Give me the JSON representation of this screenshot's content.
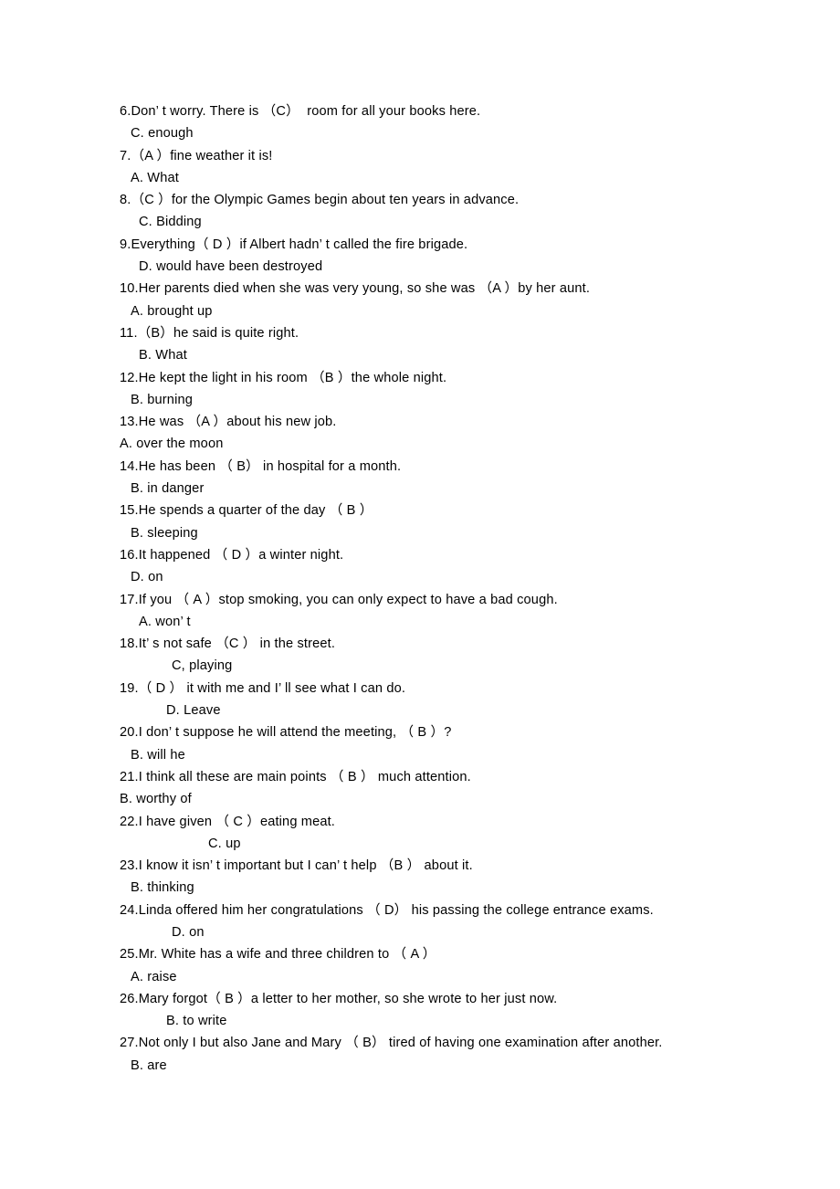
{
  "document": {
    "type": "grammar-exercise-answer-key",
    "first_item_number": 6,
    "last_item_number": 27,
    "items": [
      {
        "number": "6",
        "question": "6.Don’ t worry. There is （C）  room for all your books here.",
        "answer": "C. enough",
        "answer_indent": "indent-1"
      },
      {
        "number": "7",
        "question": "7.（A ）fine weather it is!",
        "answer": "A. What",
        "answer_indent": "indent-1"
      },
      {
        "number": "8",
        "question": "8.（C ）for the Olympic Games begin about ten years in advance.",
        "answer": "C. Bidding",
        "answer_indent": "indent-2"
      },
      {
        "number": "9",
        "question": "9.Everything（ D ）if Albert hadn’ t called the fire brigade.",
        "answer": "D. would have been destroyed",
        "answer_indent": "indent-2"
      },
      {
        "number": "10",
        "question": "10.Her parents died when she was very young, so she was （A ）by her aunt.",
        "answer": "A. brought up",
        "answer_indent": "indent-1"
      },
      {
        "number": "11",
        "question": "11.（B）he said is quite right.",
        "answer": "B. What",
        "answer_indent": "indent-2"
      },
      {
        "number": "12",
        "question": "12.He kept the light in his room （B ）the whole night.",
        "answer": "B. burning",
        "answer_indent": "indent-1"
      },
      {
        "number": "13",
        "question": "13.He was （A ）about his new job.",
        "answer": "A. over the moon",
        "answer_indent": "indent-0"
      },
      {
        "number": "14",
        "question": "14.He has been （ B） in hospital for a month.",
        "answer": "B. in danger",
        "answer_indent": "indent-1"
      },
      {
        "number": "15",
        "question": "15.He spends a quarter of the day （ B ）",
        "answer": "B. sleeping",
        "answer_indent": "indent-1"
      },
      {
        "number": "16",
        "question": "16.It happened （ D ）a winter night.",
        "answer": "D. on",
        "answer_indent": "indent-1"
      },
      {
        "number": "17",
        "question": "17.If you （ A ）stop smoking, you can only expect to have a bad cough.",
        "answer": "A. won’ t",
        "answer_indent": "indent-2"
      },
      {
        "number": "18",
        "question": "18.It’ s not safe （C ） in the street.",
        "answer": "C, playing",
        "answer_indent": "indent-5"
      },
      {
        "number": "19",
        "question": "19.（ D ） it with me and I’ ll see what I can do.",
        "answer": "D. Leave",
        "answer_indent": "indent-4"
      },
      {
        "number": "20",
        "question": "20.I don’ t suppose he will attend the meeting, （ B ）?",
        "answer": "B. will he",
        "answer_indent": "indent-1"
      },
      {
        "number": "21",
        "question": "21.I think all these are main points （ B ） much attention.",
        "answer": "B. worthy of",
        "answer_indent": "indent-0"
      },
      {
        "number": "22",
        "question": "22.I have given （ C ）eating meat.",
        "answer": "C. up",
        "answer_indent": "indent-7"
      },
      {
        "number": "23",
        "question": "23.I know it isn’ t important but I can’ t help （B ） about it.",
        "answer": "B. thinking",
        "answer_indent": "indent-1"
      },
      {
        "number": "24",
        "question": "24.Linda offered him her congratulations （ D） his passing the college entrance exams.",
        "answer": "D. on",
        "answer_indent": "indent-5"
      },
      {
        "number": "25",
        "question": "25.Mr. White has a wife and three children to （ A ）",
        "answer": "A. raise",
        "answer_indent": "indent-1"
      },
      {
        "number": "26",
        "question": "26.Mary forgot（ B ）a letter to her mother, so she wrote to her just now.",
        "answer": "B. to write",
        "answer_indent": "indent-4"
      },
      {
        "number": "27",
        "question": "27.Not only I but also Jane and Mary （ B） tired of having one examination after another.",
        "answer": "B. are",
        "answer_indent": "indent-1"
      }
    ]
  }
}
